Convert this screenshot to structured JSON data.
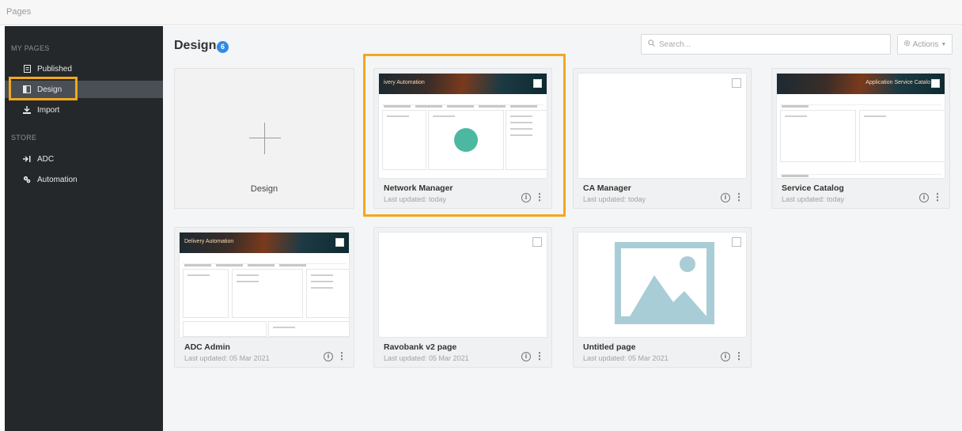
{
  "window": {
    "title": "Pages"
  },
  "sidebar": {
    "section_my_pages": "MY PAGES",
    "section_store": "STORE",
    "items": [
      {
        "label": "Published",
        "icon": "published-icon"
      },
      {
        "label": "Design",
        "icon": "design-icon",
        "active": true
      },
      {
        "label": "Import",
        "icon": "import-icon"
      },
      {
        "label": "ADC",
        "icon": "adc-icon"
      },
      {
        "label": "Automation",
        "icon": "automation-icon"
      }
    ]
  },
  "header": {
    "title": "Design",
    "count": "6",
    "search_placeholder": "Search...",
    "actions_label": "Actions"
  },
  "design_tile": {
    "label": "Design"
  },
  "cards": [
    {
      "name": "Network Manager",
      "date": "Last updated: today",
      "banner_text": "ivery Automation",
      "selected": true
    },
    {
      "name": "CA Manager",
      "date": "Last updated: today"
    },
    {
      "name": "Service Catalog",
      "date": "Last updated: today",
      "banner_text": "Application Service Catalo"
    },
    {
      "name": "ADC Admin",
      "date": "Last updated: 05 Mar 2021",
      "banner_text": "Delivery Automation"
    },
    {
      "name": "Ravobank v2 page",
      "date": "Last updated: 05 Mar 2021"
    },
    {
      "name": "Untitled page",
      "date": "Last updated: 05 Mar 2021"
    }
  ],
  "colors": {
    "highlight": "#f2a81e",
    "badge": "#2e8be8",
    "sidebar": "#25282b",
    "accent_teal": "#4db8a2",
    "placeholder_image": "#a9cdd6"
  }
}
